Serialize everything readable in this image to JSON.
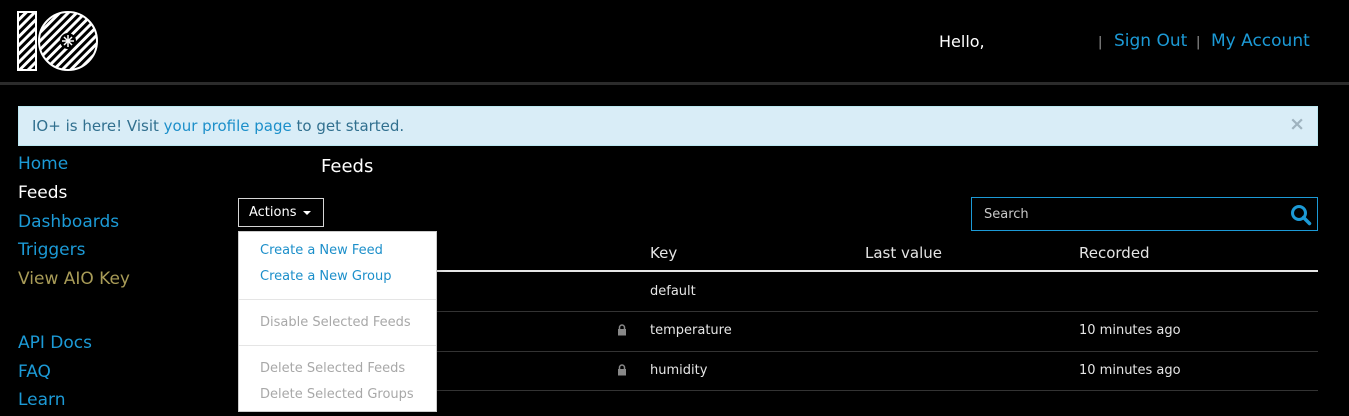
{
  "header": {
    "greeting": "Hello,",
    "separator": "|",
    "sign_out": "Sign Out",
    "my_account": "My Account"
  },
  "alert": {
    "prefix": "IO+ is here! Visit ",
    "link": "your profile page",
    "suffix": " to get started.",
    "close": "×"
  },
  "sidebar": {
    "items": [
      {
        "label": "Home"
      },
      {
        "label": "Feeds"
      },
      {
        "label": "Dashboards"
      },
      {
        "label": "Triggers"
      },
      {
        "label": "View AIO Key"
      },
      {
        "label": "API Docs"
      },
      {
        "label": "FAQ"
      },
      {
        "label": "Learn"
      }
    ]
  },
  "main": {
    "title": "Feeds",
    "actions_label": "Actions",
    "search_placeholder": "Search",
    "columns": [
      "Key",
      "Last value",
      "Recorded"
    ],
    "rows": [
      {
        "key": "default",
        "last_value": "",
        "recorded": "",
        "locked": false
      },
      {
        "key": "temperature",
        "last_value": "",
        "recorded": "10 minutes ago",
        "locked": true
      },
      {
        "key": "humidity",
        "last_value": "",
        "recorded": "10 minutes ago",
        "locked": true
      }
    ]
  },
  "actions_menu": {
    "items": [
      {
        "label": "Create a New Feed",
        "enabled": true
      },
      {
        "label": "Create a New Group",
        "enabled": true
      },
      {
        "label": "Disable Selected Feeds",
        "enabled": false
      },
      {
        "label": "Delete Selected Feeds",
        "enabled": false
      },
      {
        "label": "Delete Selected Groups",
        "enabled": false
      }
    ]
  },
  "colors": {
    "accent": "#1c9ad6",
    "alert_bg": "#d9edf7",
    "aio_key": "#a89b57"
  }
}
